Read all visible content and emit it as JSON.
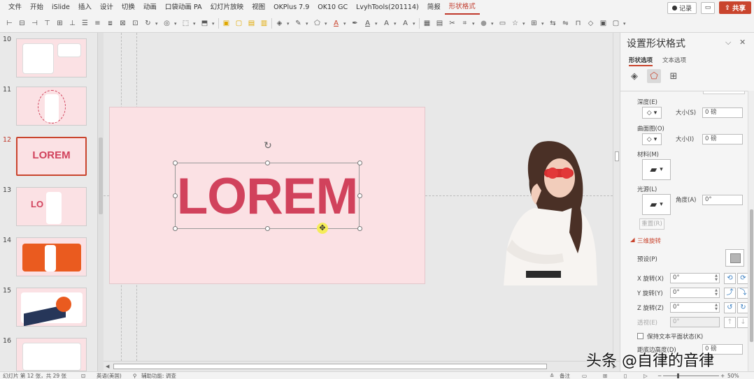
{
  "menu": {
    "items": [
      "文件",
      "开始",
      "iSlide",
      "插入",
      "设计",
      "切换",
      "动画",
      "口袋动画 PA",
      "幻灯片放映",
      "视图",
      "OKPlus 7.9",
      "OK10 GC",
      "LvyhTools(201114)",
      "简报",
      "形状格式"
    ],
    "active_index": 14,
    "record_label": "记录",
    "share_label": "共享"
  },
  "thumbnails": [
    {
      "number": "10",
      "kind": "ui"
    },
    {
      "number": "11",
      "kind": "portrait"
    },
    {
      "number": "12",
      "kind": "lorem",
      "text": "LOREM",
      "selected": true
    },
    {
      "number": "13",
      "kind": "lorem-portrait",
      "text": "LO  M"
    },
    {
      "number": "14",
      "kind": "orange"
    },
    {
      "number": "15",
      "kind": "collage"
    },
    {
      "number": "16",
      "kind": "ui"
    }
  ],
  "slide": {
    "title_text": "LOREM",
    "accent_color": "#d1425c",
    "background_color": "#fbe1e4"
  },
  "panel": {
    "title": "设置形状格式",
    "tabs": [
      "形状选项",
      "文本选项"
    ],
    "active_tab": 0,
    "labels": {
      "depth": "深度(E)",
      "depth_size": "大小(S)",
      "depth_size_value": "0 磅",
      "contour": "曲面图(O)",
      "contour_size": "大小(I)",
      "contour_size_value": "0 磅",
      "material": "材料(M)",
      "lighting": "光源(L)",
      "angle": "角度(A)",
      "angle_value": "0°",
      "reset": "重置(R)",
      "rotation_section": "三维旋转",
      "preset": "预设(P)",
      "x_rotation": "X 旋转(X)",
      "x_rotation_value": "0°",
      "y_rotation": "Y 旋转(Y)",
      "y_rotation_value": "0°",
      "z_rotation": "Z 旋转(Z)",
      "z_rotation_value": "0°",
      "perspective": "透视(E)",
      "perspective_value": "0°",
      "keep_flat": "保持文本平面状态(K)",
      "distance": "距底边高度(D)",
      "distance_value": "0 磅"
    }
  },
  "status": {
    "slide_info": "幻灯片 第 12 张，共 29 张",
    "language": "英语(美国)",
    "accessibility": "辅助功能: 调查",
    "notes": "备注",
    "zoom": "50%"
  },
  "watermark": "头条 @自律的音律"
}
